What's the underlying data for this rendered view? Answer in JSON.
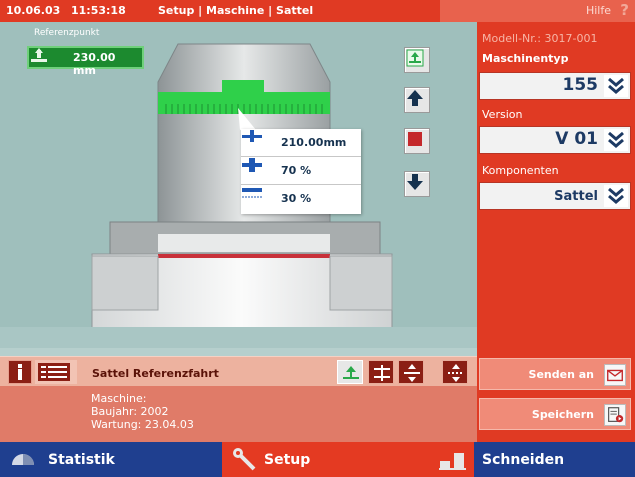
{
  "titlebar": {
    "date": "10.06.03",
    "time": "11:53:18",
    "breadcrumb": "Setup | Maschine | Sattel",
    "help": "Hilfe",
    "help_icon": "?"
  },
  "main": {
    "reference_label": "Referenzpunkt",
    "reference_value": "230.00 mm",
    "popup": [
      {
        "icon": "height-icon",
        "value": "210.00mm"
      },
      {
        "icon": "force-icon",
        "value": "70 %"
      },
      {
        "icon": "speed-icon",
        "value": "30 %"
      }
    ],
    "tools": [
      "reference-icon",
      "arrow-up-icon",
      "stop-icon",
      "arrow-down-icon"
    ]
  },
  "strip": {
    "title": "Sattel Referenzfahrt",
    "buttons": [
      "reference-mode-icon",
      "step-mode-icon",
      "jog-mode-icon",
      "auto-mode-icon"
    ]
  },
  "info": {
    "line1": "Maschine:",
    "line2": "Baujahr: 2002",
    "line3": "Wartung: 23.04.03"
  },
  "right": {
    "model": "Modell-Nr.: 3017-001",
    "maschinentyp_label": "Maschinentyp",
    "maschinentyp_value": "155",
    "version_label": "Version",
    "version_value": "V 01",
    "komponenten_label": "Komponenten",
    "komponenten_value": "Sattel",
    "send_label": "Senden an",
    "save_label": "Speichern"
  },
  "nav": {
    "statistik": "Statistik",
    "setup": "Setup",
    "schneiden": "Schneiden"
  },
  "colors": {
    "accent_red": "#e03a23",
    "nav_blue": "#1f3f8f",
    "highlight_green": "#2fd04a"
  }
}
